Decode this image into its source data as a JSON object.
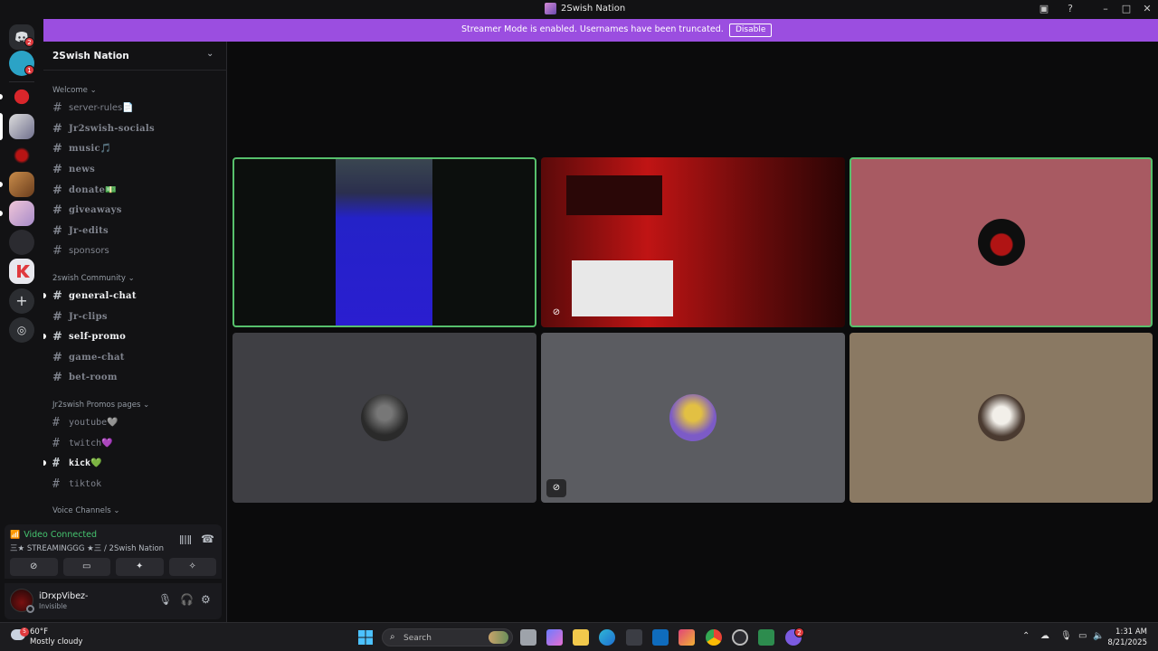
{
  "window": {
    "title": "2Swish Nation"
  },
  "banner": {
    "message": "Streamer Mode is enabled. Usernames have been truncated.",
    "disable_label": "Disable"
  },
  "rail": {
    "dm_badge": "2",
    "server_badge": "1"
  },
  "server": {
    "name": "2Swish Nation"
  },
  "categories": {
    "welcome": "Welcome ⌄",
    "community": "2swish Community ⌄",
    "promos": "Jr2swish Promos pages ⌄",
    "voice": "Voice Channels ⌄"
  },
  "channels": {
    "server_rules": "server-rules📄",
    "socials": "Jr2swish-socials",
    "music": "music🎵",
    "news": "news",
    "donate": "donate💵",
    "giveaways": "giveaways",
    "edits": "Jr-edits",
    "sponsors": "sponsors",
    "general": "general-chat",
    "clips": "Jr-clips",
    "promo": "self-promo",
    "game": "game-chat",
    "bet": "bet-room",
    "youtube": "youtube🩶",
    "twitch": "twitch💜",
    "kick": "kick💚",
    "tiktok": "tiktok"
  },
  "voice": {
    "status": "Video Connected",
    "channel": "三★ STREAMINGGG ★三 / 2Swish Nation"
  },
  "user": {
    "name": "iDrxpVibez-",
    "status": "Invisible"
  },
  "taskbar": {
    "weather_badge": "5",
    "temp": "60°F",
    "condition": "Mostly cloudy",
    "search_placeholder": "Search",
    "time": "1:31 AM",
    "date": "8/21/2025",
    "discord_badge": "2"
  },
  "colors": {
    "accent": "#9b4ee0",
    "speaking": "#57c06c",
    "voice_connected": "#45c46f"
  }
}
